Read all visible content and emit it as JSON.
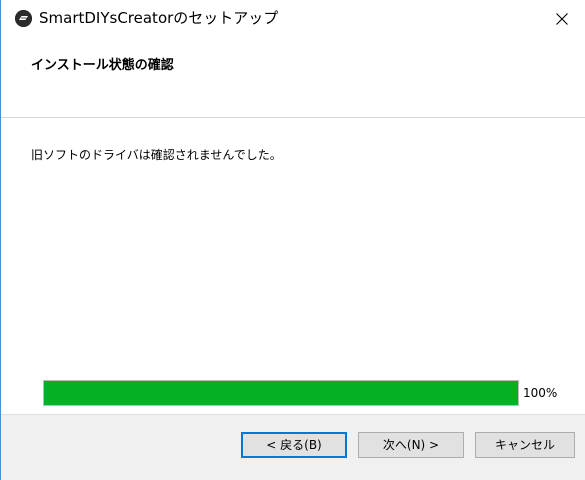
{
  "window": {
    "title": "SmartDIYsCreatorのセットアップ"
  },
  "header": {
    "title": "インストール状態の確認"
  },
  "main": {
    "message": "旧ソフトのドライバは確認されませんでした。",
    "progress": {
      "percent_label": "100%",
      "value": 1.0,
      "fill_color": "#06b025"
    }
  },
  "footer": {
    "back_label": "< 戻る(B)",
    "next_label": "次へ(N) >",
    "cancel_label": "キャンセル"
  },
  "icons": {
    "app": "app-logo-icon",
    "close": "close-icon"
  },
  "colors": {
    "focus_border": "#0078d7",
    "window_border": "#4a90d9"
  }
}
